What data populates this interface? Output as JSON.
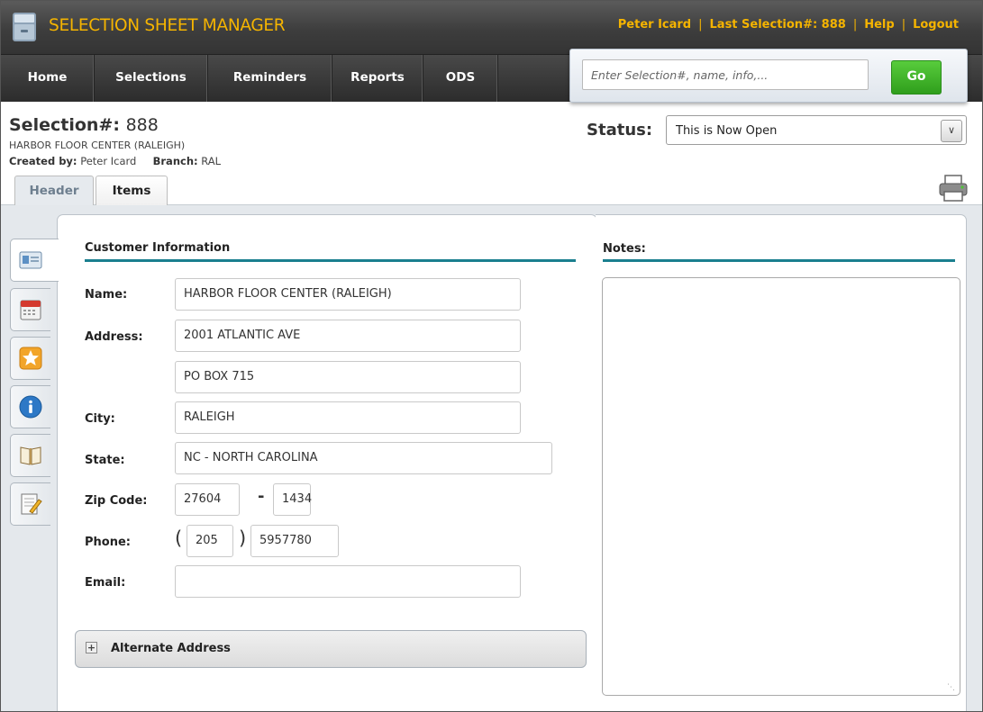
{
  "app": {
    "title": "SELECTION SHEET MANAGER",
    "user": "Peter Icard",
    "last_selection": "Last Selection#: 888",
    "help": "Help",
    "logout": "Logout",
    "accent_color": "#f5b400"
  },
  "nav": {
    "items": [
      "Home",
      "Selections",
      "Reminders",
      "Reports",
      "ODS"
    ]
  },
  "search": {
    "placeholder": "Enter Selection#, name, info,...",
    "value": "",
    "button": "Go"
  },
  "selection": {
    "label": "Selection#:",
    "number": "888",
    "company": "HARBOR FLOOR CENTER (RALEIGH)",
    "created_by_label": "Created by:",
    "created_by": "Peter Icard",
    "branch_label": "Branch:",
    "branch": "RAL"
  },
  "status": {
    "label": "Status:",
    "value": "This is Now Open"
  },
  "tabs": [
    "Header",
    "Items"
  ],
  "side_tabs": [
    "id-card-icon",
    "calendar-icon",
    "star-icon",
    "info-icon",
    "book-icon",
    "notepad-icon"
  ],
  "customer": {
    "section_title": "Customer Information",
    "name_label": "Name:",
    "name": "HARBOR FLOOR CENTER (RALEIGH)",
    "address_label": "Address:",
    "address1": "2001 ATLANTIC AVE",
    "address2": "PO BOX 715",
    "city_label": "City:",
    "city": "RALEIGH",
    "state_label": "State:",
    "state": "NC - NORTH CAROLINA",
    "zip_label": "Zip Code:",
    "zip": "27604",
    "zip_ext": "1434",
    "zip_sep": "-",
    "phone_label": "Phone:",
    "phone_area": "205",
    "phone_number": "5957780",
    "phone_open": "(",
    "phone_close": ")",
    "email_label": "Email:",
    "email": ""
  },
  "alternate_address": {
    "label": "Alternate Address",
    "toggle": "+"
  },
  "notes": {
    "label": "Notes:",
    "value": ""
  }
}
